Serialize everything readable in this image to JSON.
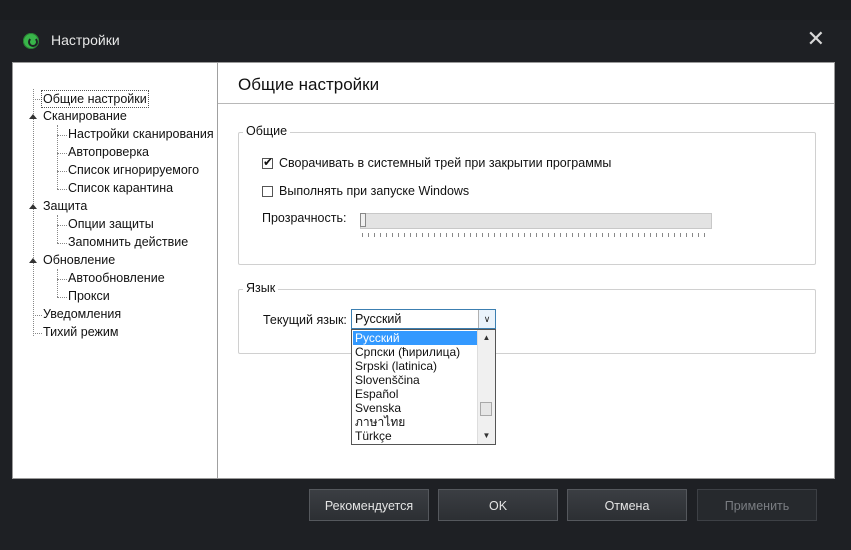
{
  "window": {
    "title": "Настройки",
    "close_glyph": "✕",
    "icon": "app-logo-icon"
  },
  "tree": {
    "items": [
      {
        "label": "Общие настройки",
        "level": 0,
        "selected": true
      },
      {
        "label": "Сканирование",
        "level": 0,
        "expandable": true
      },
      {
        "label": "Настройки сканирования",
        "level": 1
      },
      {
        "label": "Автопроверка",
        "level": 1
      },
      {
        "label": "Список игнорируемого",
        "level": 1
      },
      {
        "label": "Список карантина",
        "level": 1
      },
      {
        "label": "Защита",
        "level": 0,
        "expandable": true
      },
      {
        "label": "Опции защиты",
        "level": 1
      },
      {
        "label": "Запомнить действие",
        "level": 1
      },
      {
        "label": "Обновление",
        "level": 0,
        "expandable": true
      },
      {
        "label": "Автообновление",
        "level": 1
      },
      {
        "label": "Прокси",
        "level": 1
      },
      {
        "label": "Уведомления",
        "level": 0
      },
      {
        "label": "Тихий режим",
        "level": 0
      }
    ]
  },
  "panel": {
    "title": "Общие настройки",
    "general_group": {
      "label": "Общие",
      "minimize_to_tray": {
        "label": "Сворачивать в системный трей при закрытии программы",
        "checked": true
      },
      "run_on_startup": {
        "label": "Выполнять при запуске Windows",
        "checked": false
      },
      "transparency_label": "Прозрачность:",
      "transparency_value": 0
    },
    "language_group": {
      "label": "Язык",
      "current_label": "Текущий язык:",
      "selected": "Русский",
      "options": [
        "Русский",
        "Српски (ћирилица)",
        "Srpski (latinica)",
        "Slovenščina",
        "Español",
        "Svenska",
        "ภาษาไทย",
        "Türkçe"
      ]
    }
  },
  "footer": {
    "recommended": "Рекомендуется",
    "ok": "OK",
    "cancel": "Отмена",
    "apply": "Применить",
    "apply_disabled": true
  },
  "colors": {
    "accent": "#3399ff",
    "app_icon": "#39b54a",
    "window_bg": "#1e2024"
  }
}
